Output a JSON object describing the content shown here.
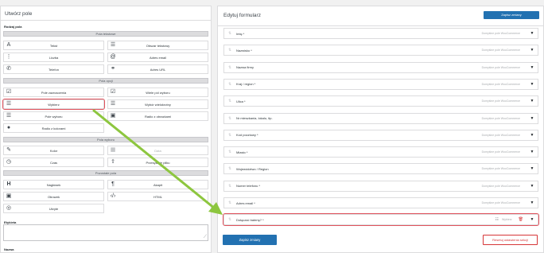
{
  "left": {
    "title": "Utwórz pole",
    "field_type_label": "Rodzaj pola",
    "groups": {
      "text": "Pola tekstowe",
      "options": "Pola opcji",
      "pickers": "Pola wyboru",
      "other": "Pozostałe pola"
    },
    "buttons": {
      "text": "Tekst",
      "textarea": "Obszar tekstowy",
      "number": "Liczba",
      "email": "Adres email",
      "phone": "Telefon",
      "url": "Adres URL",
      "checkbox": "Pole zaznaczenia",
      "multicheckbox": "Wiele pól wyboru",
      "select": "Wybierz",
      "multiselect": "Wybór wielokrotny",
      "radio": "Pole wyboru",
      "radio_images": "Radio z obrazkami",
      "radio_colors": "Radio z kolorami",
      "color": "Kolor",
      "date": "Data",
      "time": "Czas",
      "file": "Przesyłanie pliku",
      "heading": "Nagłówek",
      "paragraph": "Akapit",
      "image": "Obrazek",
      "html": "HTML",
      "hidden": "Ukryte"
    },
    "label_caption": "Etykieta",
    "name_caption": "Nazwa"
  },
  "right": {
    "title": "Edytuj formularz",
    "save_top": "Zapisz zmiany",
    "default_tag": "Domyślne pole WooCommerce",
    "custom_tag": "Wybierz",
    "rows": [
      "Imię *",
      "Nazwisko *",
      "Nazwa firmy",
      "Kraj / region *",
      "Ulica *",
      "Nr mieszkania, lokalu, itp.",
      "Kod pocztowy *",
      "Miasto *",
      "Województwo / Region",
      "Numer telefonu *",
      "Adres email *"
    ],
    "custom_row": "Dołączać baterię? *",
    "save_bottom": "Zapisz zmiany",
    "reset": "Resetuj ustawienia sekcji"
  },
  "colors": {
    "primary": "#2271b1",
    "danger": "#d63638",
    "highlight": "#e0525c",
    "arrow": "#8dc63f"
  },
  "icons": {
    "text": "text-icon",
    "textarea": "paragraph-lines-icon",
    "number": "list-ordered-icon",
    "email": "at-icon",
    "phone": "phone-icon",
    "url": "link-icon",
    "checkbox": "checkbox-icon",
    "multicheckbox": "checklist-icon",
    "select": "select-list-icon",
    "multiselect": "bullet-list-icon",
    "radio": "bullet-list-icon",
    "radio_images": "images-icon",
    "radio_colors": "palette-icon",
    "color": "brush-icon",
    "date": "calendar-icon",
    "time": "clock-icon",
    "file": "upload-icon",
    "heading": "heading-icon",
    "paragraph": "pilcrow-icon",
    "image": "image-icon",
    "html": "code-icon",
    "hidden": "eye-hidden-icon",
    "drag": "drag-handle-icon",
    "toggle": "caret-down-icon"
  }
}
